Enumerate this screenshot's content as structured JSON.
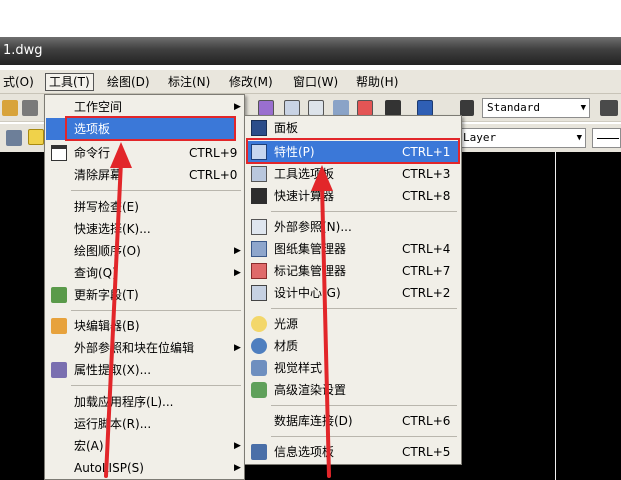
{
  "window": {
    "title": "1.dwg"
  },
  "menubar": {
    "items": [
      "式(O)",
      "工具(T)",
      "绘图(D)",
      "标注(N)",
      "修改(M)",
      "窗口(W)",
      "帮助(H)"
    ]
  },
  "toolbar": {
    "text_style": "Standard",
    "layer": "Layer"
  },
  "tools_menu": {
    "items": [
      {
        "label": "工作空间",
        "shortcut": "",
        "submenu": true
      },
      {
        "label": "选项板",
        "shortcut": "",
        "submenu": true,
        "highlighted": true
      },
      {
        "label": "命令行",
        "shortcut": "CTRL+9"
      },
      {
        "label": "清除屏幕",
        "shortcut": "CTRL+0"
      },
      {
        "label": "拼写检查(E)",
        "shortcut": ""
      },
      {
        "label": "快速选择(K)...",
        "shortcut": ""
      },
      {
        "label": "绘图顺序(O)",
        "shortcut": "",
        "submenu": true
      },
      {
        "label": "查询(Q)",
        "shortcut": "",
        "submenu": true
      },
      {
        "label": "更新字段(T)",
        "shortcut": ""
      },
      {
        "label": "块编辑器(B)",
        "shortcut": ""
      },
      {
        "label": "外部参照和块在位编辑",
        "shortcut": "",
        "submenu": true
      },
      {
        "label": "属性提取(X)...",
        "shortcut": ""
      },
      {
        "label": "加载应用程序(L)...",
        "shortcut": ""
      },
      {
        "label": "运行脚本(R)...",
        "shortcut": ""
      },
      {
        "label": "宏(A)",
        "shortcut": "",
        "submenu": true
      },
      {
        "label": "AutoLISP(S)",
        "shortcut": "",
        "submenu": true
      }
    ]
  },
  "palettes_menu": {
    "items": [
      {
        "label": "面板",
        "shortcut": ""
      },
      {
        "label": "特性(P)",
        "shortcut": "CTRL+1",
        "highlighted": true
      },
      {
        "label": "工具选项板",
        "shortcut": "CTRL+3"
      },
      {
        "label": "快速计算器",
        "shortcut": "CTRL+8"
      },
      {
        "label": "外部参照(N)...",
        "shortcut": ""
      },
      {
        "label": "图纸集管理器",
        "shortcut": "CTRL+4"
      },
      {
        "label": "标记集管理器",
        "shortcut": "CTRL+7"
      },
      {
        "label": "设计中心(G)",
        "shortcut": "CTRL+2"
      },
      {
        "label": "光源",
        "shortcut": ""
      },
      {
        "label": "材质",
        "shortcut": ""
      },
      {
        "label": "视觉样式",
        "shortcut": ""
      },
      {
        "label": "高级渲染设置",
        "shortcut": ""
      },
      {
        "label": "数据库连接(D)",
        "shortcut": "CTRL+6"
      },
      {
        "label": "信息选项板",
        "shortcut": "CTRL+5"
      }
    ]
  },
  "colors": {
    "highlight": "#3b78d8",
    "annotation": "#e2262a",
    "drawing_area": "#000000"
  }
}
